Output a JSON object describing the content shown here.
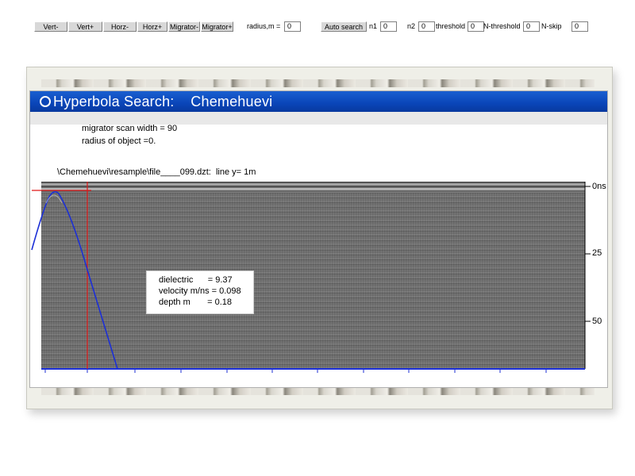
{
  "window": {
    "title": "Hyperbola Search:    Chemehuevi"
  },
  "toolbar": {
    "buttons": [
      "Vert-",
      "Vert+",
      "Horz-",
      "Horz+",
      "Migrator-",
      "Migrator+",
      "Auto search"
    ],
    "fields": [
      {
        "label": "radius,m =",
        "value": "0"
      },
      {
        "label": "n1",
        "value": "0"
      },
      {
        "label": "n2",
        "value": "0"
      },
      {
        "label": "threshold",
        "value": "0"
      },
      {
        "label": "N-threshold",
        "value": "0"
      },
      {
        "label": "N-skip",
        "value": "0"
      }
    ]
  },
  "info": {
    "migrator": "migrator scan width = 90",
    "radius": "radius of object =0.",
    "file": "\\Chemehuevi\\resample\\file____099.dzt:  line y= 1m"
  },
  "depth_axis": {
    "ticks": [
      "0ns",
      "25",
      "50"
    ]
  },
  "results": {
    "dielectric": "dielectric      = 9.37",
    "velocity": "velocity m/ns = 0.098",
    "depth": "depth m       = 0.18"
  },
  "colors": {
    "title_bar": "#0a45b8",
    "hyperbola": "#1c2fd6",
    "crosshair": "#e01818",
    "radargram": "#6e6e6e"
  }
}
